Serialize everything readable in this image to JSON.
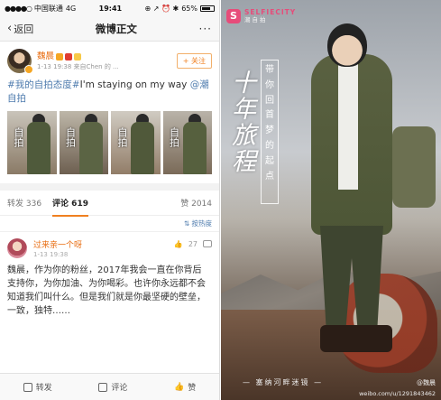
{
  "status_bar": {
    "carrier": "中国联通",
    "network": "4G",
    "time": "19:41",
    "icons": "⊕ ↗ ⏰ ✱",
    "battery": "65%"
  },
  "nav": {
    "back_label": "返回",
    "title": "微博正文",
    "more_label": "···"
  },
  "post": {
    "author": "魏晨",
    "time": "1-13 19:38",
    "source": "来自Chen 的 ...",
    "follow_label": "+ 关注",
    "text_tag": "#我的自拍态度#",
    "text_body": "I'm staying on my way ",
    "text_mention": "@潮自拍",
    "thumbnails": [
      {
        "caption": "自拍"
      },
      {
        "caption": "自拍"
      },
      {
        "caption": "自拍"
      },
      {
        "caption": "自拍"
      }
    ]
  },
  "tabs": {
    "repost": "转发 336",
    "comment": "评论 619",
    "like": "赞 2014",
    "sort": "⇅ 按热度"
  },
  "comment": {
    "name": "过来亲一个呀",
    "time": "1-13 19:38",
    "likes": "27",
    "text": "魏晨，作为你的粉丝，2017年我会一直在你背后支持你，为你加油、为你喝彩。也许你永远都不会知道我们叫什么。但是我们就是你最坚硬的壁垒，一致，独特……"
  },
  "toolbar": {
    "repost": "转发",
    "comment": "评论",
    "like": "赞"
  },
  "poster": {
    "logo_en": "SELFIECITY",
    "logo_cn": "潮自拍",
    "calligraphy": "十年旅程",
    "slogan": "带你回首梦的起点",
    "footer": "— 塞纳河畔迷镜 —",
    "watermark_name": "@魏晨",
    "watermark_url": "weibo.com/u/1291843462"
  },
  "colors": {
    "accent_orange": "#f08020",
    "link_blue": "#4f7cae",
    "brand_pink": "#e74c7a"
  }
}
